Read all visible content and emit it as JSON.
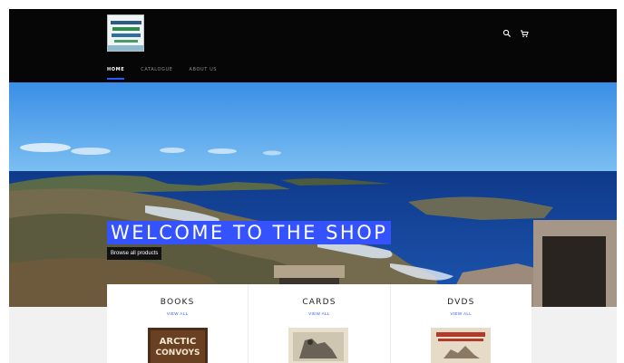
{
  "header": {
    "logo_alt": "store-logo",
    "icons": [
      "search-icon",
      "cart-icon"
    ]
  },
  "nav": {
    "items": [
      {
        "label": "HOME",
        "active": true
      },
      {
        "label": "CATALOGUE",
        "active": false
      },
      {
        "label": "ABOUT US",
        "active": false
      }
    ]
  },
  "hero": {
    "title": "WELCOME TO THE SHOP",
    "button_label": "Browse all products",
    "accent_color": "#3552ff"
  },
  "collections": [
    {
      "title": "BOOKS",
      "link": "VIEW ALL",
      "cover_text": "ARCTIC CONVOYS"
    },
    {
      "title": "CARDS",
      "link": "VIEW ALL"
    },
    {
      "title": "DVDS",
      "link": "VIEW ALL"
    }
  ]
}
